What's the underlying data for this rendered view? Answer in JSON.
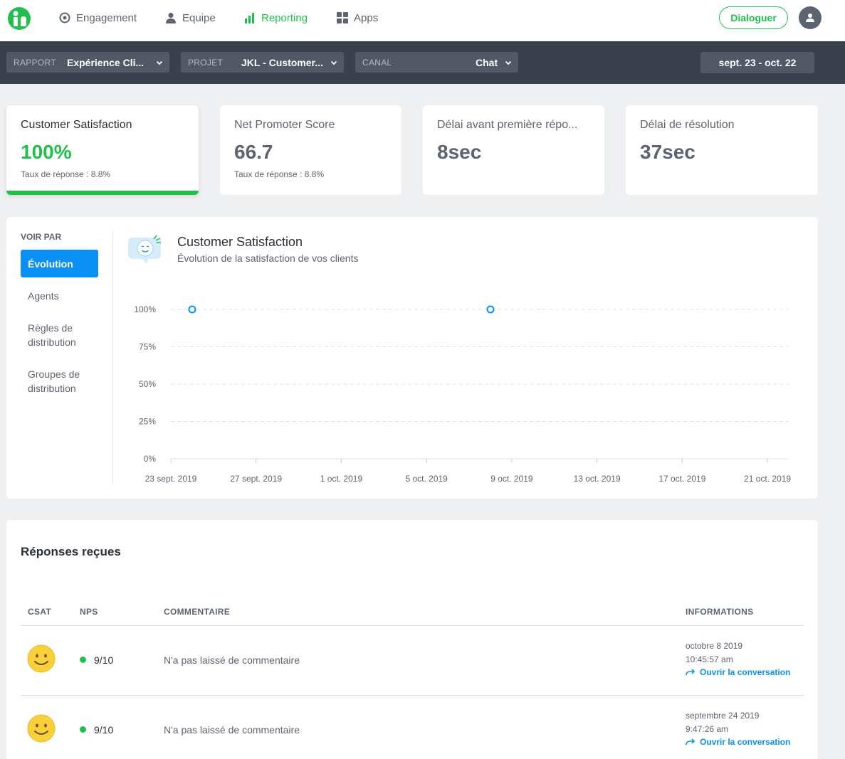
{
  "nav": {
    "items": [
      {
        "label": "Engagement",
        "icon": "target-icon"
      },
      {
        "label": "Equipe",
        "icon": "person-icon"
      },
      {
        "label": "Reporting",
        "icon": "bar-chart-icon"
      },
      {
        "label": "Apps",
        "icon": "grid-icon"
      }
    ],
    "cta_label": "Dialoguer"
  },
  "filters": {
    "rapport": {
      "label": "RAPPORT",
      "value": "Expérience Cli..."
    },
    "projet": {
      "label": "PROJET",
      "value": "JKL - Customer..."
    },
    "canal": {
      "label": "CANAL",
      "value": "Chat"
    },
    "date_range": "sept. 23 - oct. 22"
  },
  "kpis": [
    {
      "title": "Customer Satisfaction",
      "value": "100%",
      "sub": "Taux de réponse : 8.8%"
    },
    {
      "title": "Net Promoter Score",
      "value": "66.7",
      "sub": "Taux de réponse : 8.8%"
    },
    {
      "title": "Délai avant première répo...",
      "value": "8sec"
    },
    {
      "title": "Délai de résolution",
      "value": "37sec"
    }
  ],
  "sidebar": {
    "label": "VOIR PAR",
    "items": [
      "Évolution",
      "Agents",
      "Règles de distribution",
      "Groupes de distribution"
    ]
  },
  "chart_header": {
    "title": "Customer Satisfaction",
    "subtitle": "Évolution de la satisfaction de vos clients"
  },
  "chart_data": {
    "type": "scatter",
    "yticks": [
      "100%",
      "75%",
      "50%",
      "25%",
      "0%"
    ],
    "ylim": [
      0,
      100
    ],
    "xticks": [
      "23 sept. 2019",
      "27 sept. 2019",
      "1 oct. 2019",
      "5 oct. 2019",
      "9 oct. 2019",
      "13 oct. 2019",
      "17 oct. 2019",
      "21 oct. 2019"
    ],
    "x_day_range": [
      0,
      29
    ],
    "grid": true,
    "series": [
      {
        "points": [
          {
            "x": "24 sept. 2019",
            "day": 1,
            "y": 100
          },
          {
            "x": "8 oct. 2019",
            "day": 15,
            "y": 100
          }
        ]
      }
    ]
  },
  "responses": {
    "title": "Réponses reçues",
    "columns": [
      "CSAT",
      "NPS",
      "COMMENTAIRE",
      "INFORMATIONS"
    ],
    "rows": [
      {
        "csat": "smiley-face-icon",
        "nps": "9/10",
        "comment": "N'a pas laissé de commentaire",
        "date": "octobre 8 2019",
        "time": "10:45:57 am",
        "link": "Ouvrir la conversation"
      },
      {
        "csat": "smiley-face-icon",
        "nps": "9/10",
        "comment": "N'a pas laissé de commentaire",
        "date": "septembre 24 2019",
        "time": "9:47:26 am",
        "link": "Ouvrir la conversation"
      }
    ]
  },
  "colors": {
    "accent": "#21c04e",
    "link": "#0a90f5",
    "dark_bar": "#3b404d"
  }
}
